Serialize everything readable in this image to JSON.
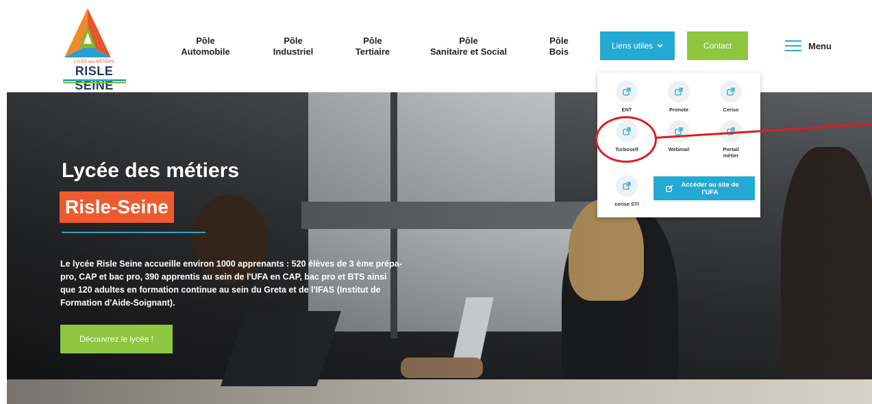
{
  "logo": {
    "name": "RISLE SEINE",
    "subtitle": "LYCÉE des MÉTIERS"
  },
  "nav": [
    {
      "line1": "Pôle",
      "line2": "Automobile"
    },
    {
      "line1": "Pôle",
      "line2": "Industriel"
    },
    {
      "line1": "Pôle",
      "line2": "Tertiaire"
    },
    {
      "line1": "Pôle",
      "line2": "Sanitaire et Social"
    },
    {
      "line1": "Pôle",
      "line2": "Bois"
    }
  ],
  "header": {
    "liens_label": "Liens utiles",
    "contact_label": "Contact",
    "menu_label": "Menu"
  },
  "dropdown": {
    "items": [
      {
        "label": "ENT"
      },
      {
        "label": "Pronote"
      },
      {
        "label": "Cerise"
      },
      {
        "label": "Turboself"
      },
      {
        "label": "Webmail"
      },
      {
        "label": "Portail métier"
      },
      {
        "label": "cerise STI"
      }
    ],
    "ufa_label": "Accéder au site de l'UFA"
  },
  "hero": {
    "title": "Lycée des métiers",
    "subtitle": "Risle-Seine",
    "text": "Le lycée Risle Seine accueille environ 1000 apprenants : 520 élèves de 3 ème prépa-pro, CAP et bac pro, 390 apprentis au sein de l'UFA en CAP, bac pro et BTS ainsi que 120 adultes en formation continue au sein du Greta et de l'IFAS (Institut de Formation d'Aide-Soignant).",
    "button_label": "Découvrez le lycée !"
  },
  "colors": {
    "blue": "#24a9d4",
    "green": "#8ec63f",
    "orange": "#ee5a2f",
    "annotation": "#e01b1b"
  }
}
